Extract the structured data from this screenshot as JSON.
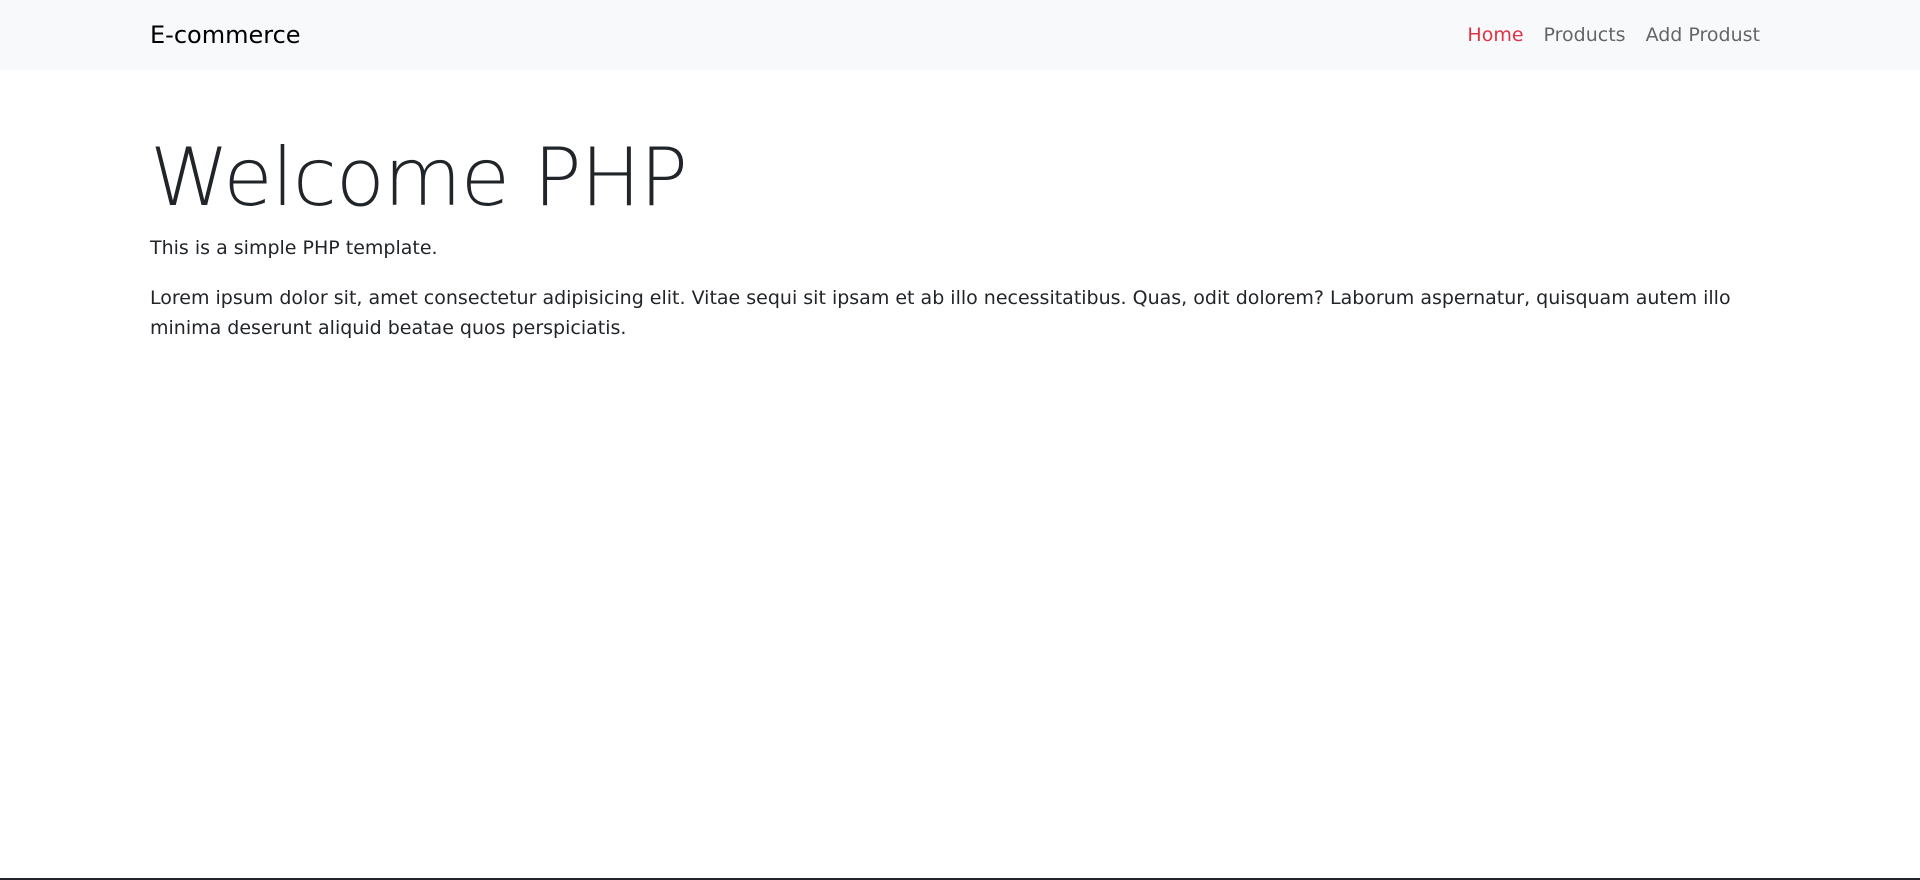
{
  "navbar": {
    "brand": "E-commerce",
    "links": [
      {
        "label": "Home",
        "active": true
      },
      {
        "label": "Products",
        "active": false
      },
      {
        "label": "Add Produst",
        "active": false
      }
    ]
  },
  "main": {
    "title": "Welcome PHP",
    "lead": "This is a simple PHP template.",
    "paragraph": "Lorem ipsum dolor sit, amet consectetur adipisicing elit. Vitae sequi sit ipsam et ab illo necessitatibus. Quas, odit dolorem? Laborum aspernatur, quisquam autem illo minima deserunt aliquid beatae quos perspiciatis."
  },
  "colors": {
    "active_link": "#dc3545",
    "navbar_bg": "#f8f9fa"
  }
}
